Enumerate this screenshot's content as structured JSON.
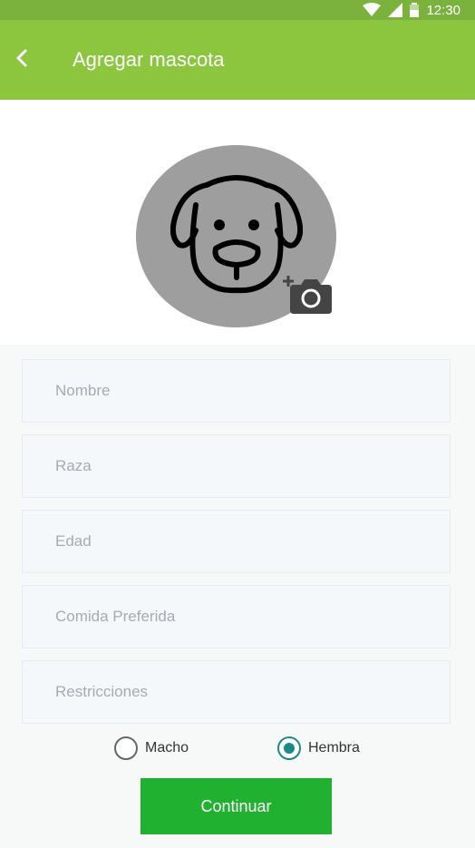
{
  "status_bar": {
    "time": "12:30"
  },
  "app_bar": {
    "title": "Agregar mascota"
  },
  "form": {
    "fields": [
      {
        "placeholder": "Nombre",
        "value": ""
      },
      {
        "placeholder": "Raza",
        "value": ""
      },
      {
        "placeholder": "Edad",
        "value": ""
      },
      {
        "placeholder": "Comida Preferida",
        "value": ""
      },
      {
        "placeholder": "Restricciones",
        "value": ""
      }
    ],
    "gender": {
      "options": [
        "Macho",
        "Hembra"
      ],
      "selected": "Hembra"
    },
    "submit_label": "Continuar"
  },
  "colors": {
    "status_bar": "#7bb23d",
    "app_bar": "#8cc63f",
    "button": "#21b131",
    "radio_accent": "#1a8a86",
    "avatar": "#9e9e9e"
  },
  "icons": {
    "back": "arrow-back-icon",
    "avatar": "dog-icon",
    "camera": "add-photo-icon",
    "wifi": "wifi-icon",
    "signal": "signal-icon",
    "battery": "battery-icon"
  }
}
